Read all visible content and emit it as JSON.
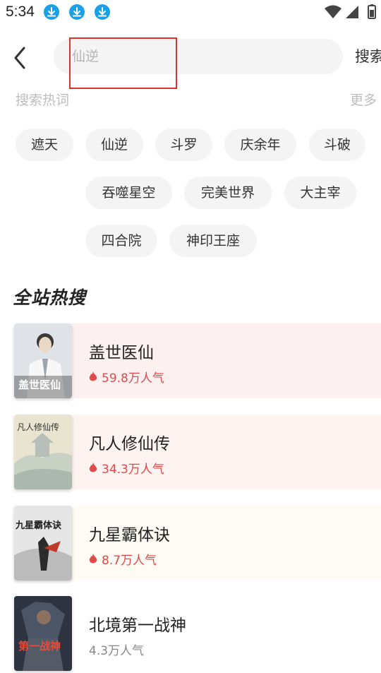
{
  "status_bar": {
    "time": "5:34"
  },
  "search": {
    "placeholder": "仙逆",
    "button_label": "搜索"
  },
  "hot_words": {
    "title": "搜索热词",
    "more": "更多",
    "chips": [
      "遮天",
      "仙逆",
      "斗罗",
      "庆余年",
      "斗破",
      "吞噬星空",
      "完美世界",
      "大主宰",
      "四合院",
      "神印王座"
    ]
  },
  "ranking": {
    "title": "全站热搜",
    "items": [
      {
        "title": "盖世医仙",
        "heat": "59.8万人气",
        "cover_text": "盖世医仙"
      },
      {
        "title": "凡人修仙传",
        "heat": "34.3万人气",
        "cover_text": "凡人修仙传"
      },
      {
        "title": "九星霸体诀",
        "heat": "8.7万人气",
        "cover_text": "九星霸体诀"
      },
      {
        "title": "北境第一战神",
        "heat": "4.3万人气",
        "cover_text": "第一战神"
      }
    ]
  },
  "colors": {
    "accent_red": "#e14a4a",
    "heat_gray": "#888888",
    "row1_bg": "#fdf0f0",
    "row2_bg": "#fdf3f0",
    "row3_bg": "#fefaf4",
    "chip_bg": "#f4f4f4"
  },
  "icons": {
    "back": "chevron-left-icon",
    "download": "download-icon",
    "flame": "flame-icon",
    "wifi": "wifi-icon",
    "signal": "signal-icon",
    "battery": "battery-icon"
  }
}
